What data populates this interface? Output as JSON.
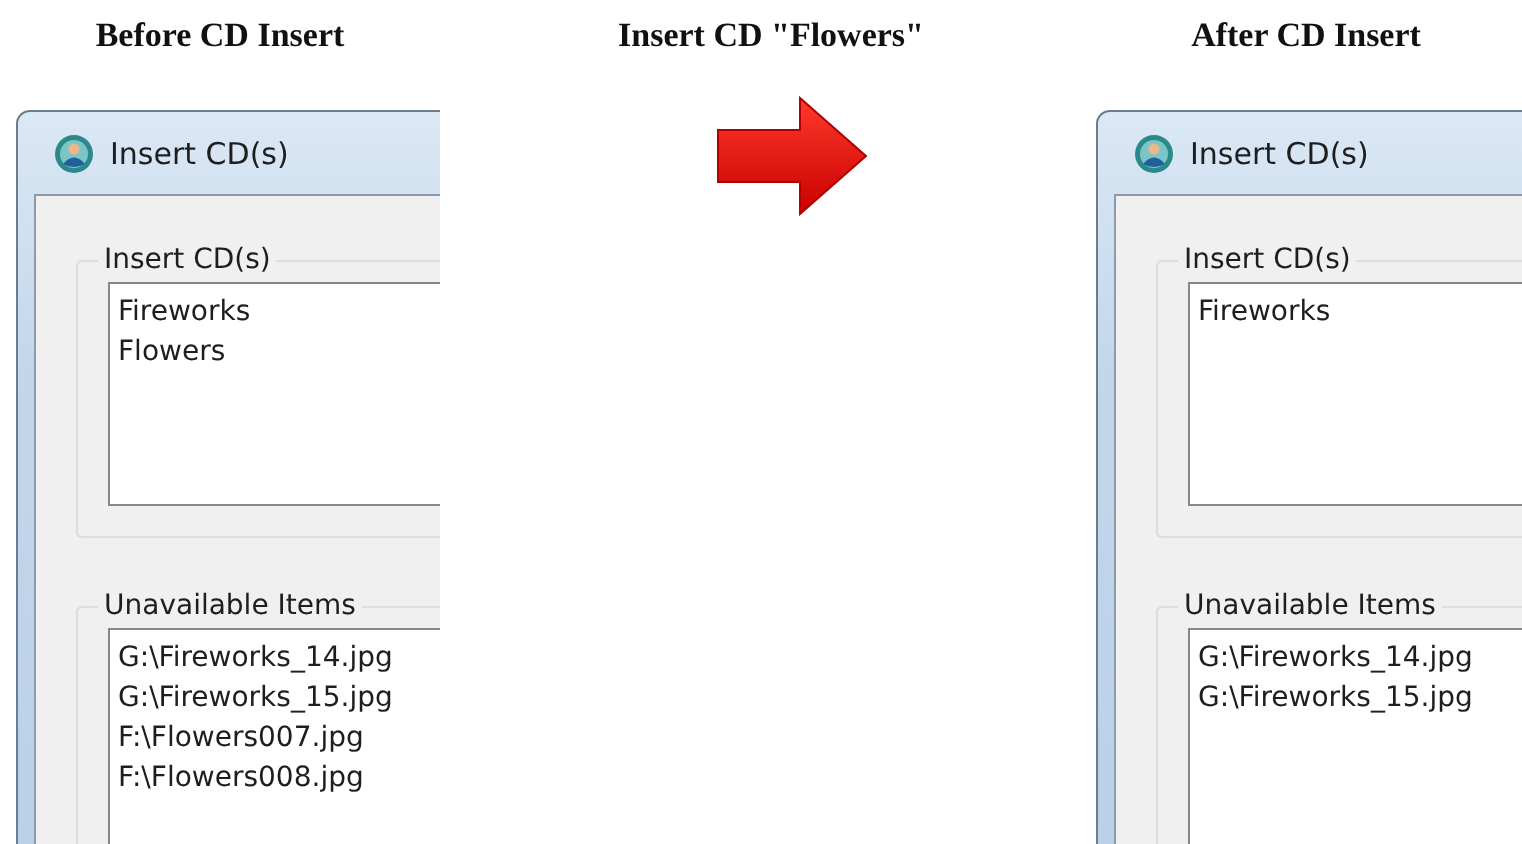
{
  "columns": [
    {
      "kind": "dialog",
      "caption": "Before CD Insert",
      "dialog": {
        "title": "Insert CD(s)",
        "groups": [
          {
            "label": "Insert CD(s)",
            "items": [
              "Fireworks",
              "Flowers"
            ]
          },
          {
            "label": "Unavailable Items",
            "items": [
              "G:\\Fireworks_14.jpg",
              "G:\\Fireworks_15.jpg",
              "F:\\Flowers007.jpg",
              "F:\\Flowers008.jpg"
            ]
          }
        ]
      }
    },
    {
      "kind": "arrow",
      "caption": "Insert CD \"Flowers\""
    },
    {
      "kind": "dialog",
      "caption": "After CD Insert",
      "dialog": {
        "title": "Insert CD(s)",
        "groups": [
          {
            "label": "Insert CD(s)",
            "items": [
              "Fireworks"
            ]
          },
          {
            "label": "Unavailable Items",
            "items": [
              "G:\\Fireworks_14.jpg",
              "G:\\Fireworks_15.jpg"
            ]
          }
        ]
      }
    }
  ]
}
